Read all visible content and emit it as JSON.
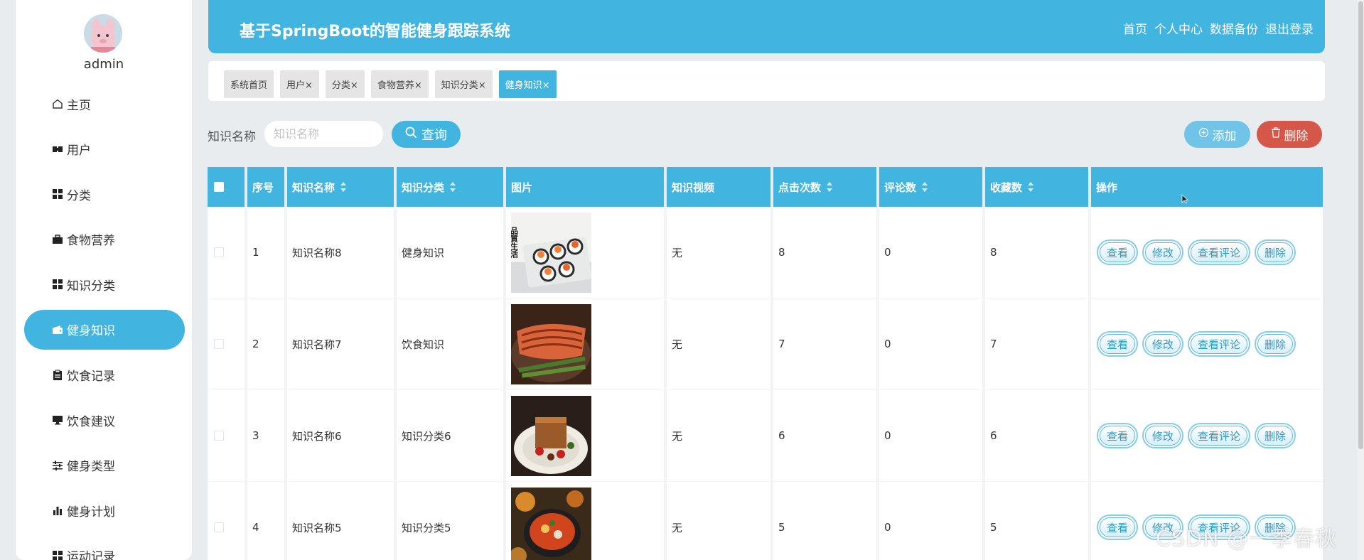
{
  "sidebar": {
    "username": "admin",
    "items": [
      {
        "label": "主页",
        "icon": "home-icon"
      },
      {
        "label": "用户",
        "icon": "users-icon"
      },
      {
        "label": "分类",
        "icon": "grid-icon"
      },
      {
        "label": "食物营养",
        "icon": "briefcase-icon"
      },
      {
        "label": "知识分类",
        "icon": "grid-icon"
      },
      {
        "label": "健身知识",
        "icon": "wallet-icon",
        "active": true
      },
      {
        "label": "饮食记录",
        "icon": "clipboard-icon"
      },
      {
        "label": "饮食建议",
        "icon": "monitor-icon"
      },
      {
        "label": "健身类型",
        "icon": "sliders-icon"
      },
      {
        "label": "健身计划",
        "icon": "bar-chart-icon"
      },
      {
        "label": "运动记录",
        "icon": "grid-icon"
      }
    ]
  },
  "header": {
    "title": "基于SpringBoot的智能健身跟踪系统",
    "nav": [
      "首页",
      "个人中心",
      "数据备份",
      "退出登录"
    ]
  },
  "tabs": [
    {
      "label": "系统首页"
    },
    {
      "label": "用户×"
    },
    {
      "label": "分类×"
    },
    {
      "label": "食物营养×"
    },
    {
      "label": "知识分类×"
    },
    {
      "label": "健身知识×",
      "active": true
    }
  ],
  "search": {
    "label": "知识名称",
    "placeholder": "知识名称",
    "value": "",
    "query_label": "查询"
  },
  "actions": {
    "add_label": "添加",
    "delete_label": "删除"
  },
  "table": {
    "columns": [
      "",
      "序号",
      "知识名称",
      "知识分类",
      "图片",
      "知识视频",
      "点击次数",
      "评论数",
      "收藏数",
      "操作"
    ],
    "sortable": [
      false,
      false,
      true,
      true,
      false,
      false,
      true,
      true,
      true,
      false
    ],
    "rows": [
      {
        "index": "1",
        "name": "知识名称8",
        "category": "健身知识",
        "image": "sushi-platter-image",
        "video": "无",
        "clicks": "8",
        "comments": "0",
        "favorites": "8"
      },
      {
        "index": "2",
        "name": "知识名称7",
        "category": "饮食知识",
        "image": "grilled-salmon-image",
        "video": "无",
        "clicks": "7",
        "comments": "0",
        "favorites": "7"
      },
      {
        "index": "3",
        "name": "知识名称6",
        "category": "知识分类6",
        "image": "dessert-plate-image",
        "video": "无",
        "clicks": "6",
        "comments": "0",
        "favorites": "6"
      },
      {
        "index": "4",
        "name": "知识名称5",
        "category": "知识分类5",
        "image": "soup-dishes-image",
        "video": "无",
        "clicks": "5",
        "comments": "0",
        "favorites": "5"
      }
    ],
    "row_actions": [
      "查看",
      "修改",
      "查看评论",
      "删除"
    ]
  },
  "image_text": {
    "sushi_caption": "品質生活"
  },
  "watermark": "CSDN @一季春秋",
  "colors": {
    "accent": "#42b4e0",
    "danger": "#d4574a",
    "background": "#e9ecee"
  }
}
